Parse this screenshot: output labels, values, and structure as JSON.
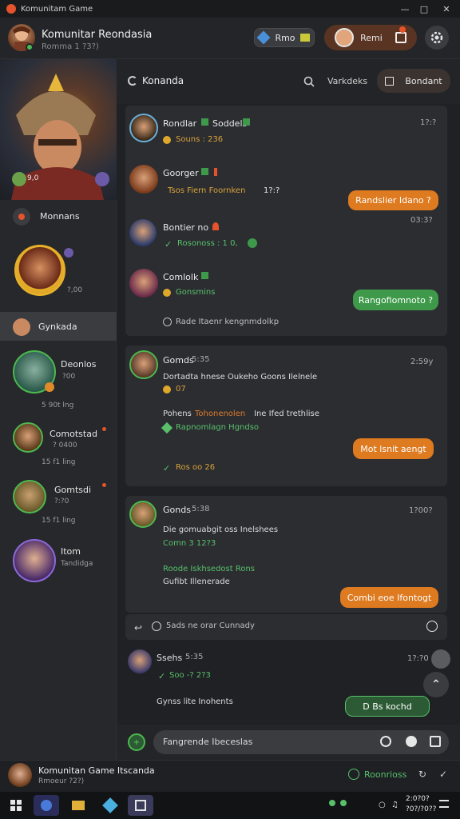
{
  "window": {
    "title": "Komunitam Game"
  },
  "header": {
    "title": "Komunitar Reondasia",
    "subtitle": "Romma 1 ?3?)",
    "pill_label": "Rmo",
    "user_name": "Remi"
  },
  "sidebar": {
    "hero_value": "9,0",
    "section_label": "Monnans",
    "featured_value": "?,00",
    "active_label": "Gynkada",
    "items": [
      {
        "name": "Deonlos",
        "meta": "?00",
        "sub": "5 90t lng"
      },
      {
        "name": "Comotstad",
        "meta": "? 0400",
        "sub": "15 f1 ling"
      },
      {
        "name": "Gomtsdi",
        "meta": "?:?0",
        "sub": "15 f1 ling"
      },
      {
        "name": "Itom",
        "meta": "Tandidga",
        "sub": ""
      }
    ]
  },
  "topbar": {
    "title": "Konanda",
    "search_label": "Varkdeks",
    "action_label": "Bondant"
  },
  "thread1": {
    "messages": [
      {
        "name": "Rondlar",
        "badge": "Soddels",
        "line": "Souns : 236",
        "time": "1?:?"
      },
      {
        "name": "Goorger",
        "line": "Tsos Fiern Foornken",
        "line_value": "1?:?"
      },
      {
        "name": "Bontier no",
        "line": "Rosonoss : 1 0,",
        "time": ""
      },
      {
        "name": "Comlolk",
        "line": "Gonsmins"
      }
    ],
    "bubble_orange": "Randslier Idano ?",
    "bubble_orange_time": "03:3?",
    "bubble_green": "Rangofiomnoto ?",
    "footer": "Rade Itaenr kengnmdolkp"
  },
  "thread2": {
    "name": "Gomds",
    "name_meta": "5:35",
    "time": "2:59y",
    "line1": "Dortadta hnese Oukeho Goons Ilelnele",
    "line1_value": "07",
    "line2_prefix": "Pohens",
    "line2_highlight": "Tohonenolen",
    "line2_rest": "Ine Ifed trethlise",
    "line3": "Rapnomlagn Hgndso",
    "bubble_orange": "Mot lsnit aengt",
    "footer": "Ros oo 26"
  },
  "thread3": {
    "name": "Gonds",
    "name_meta": "5:38",
    "time": "1?00?",
    "line1": "Die gomuabgit oss Inelshees",
    "line2": "Comn 3 12?3",
    "line3": "Roode Iskhsedost Rons",
    "line4": "Gufibt Illenerade",
    "bubble_orange": "Combi eoe Ifontogt"
  },
  "composer_hint": "5ads ne orar Cunnady",
  "thread4": {
    "name": "Ssehs",
    "name_meta": "5:35",
    "time": "1?:?0",
    "line1": "Soo -? 2?3",
    "line2": "Gynss lite Inohents",
    "bubble_green": "D Bs kochd"
  },
  "input": {
    "placeholder": "Fangrende Ibeceslas"
  },
  "footer": {
    "title": "Komunitan Game Itscanda",
    "subtitle": "Rmoeur ?2?)",
    "status_label": "Roonrioss"
  },
  "taskbar": {
    "clock_time": "2:0?0?",
    "clock_date": "?0?/?0??"
  },
  "colors": {
    "accent_orange": "#de7a1f",
    "accent_green": "#3e9a4a",
    "background": "#1f2124"
  }
}
